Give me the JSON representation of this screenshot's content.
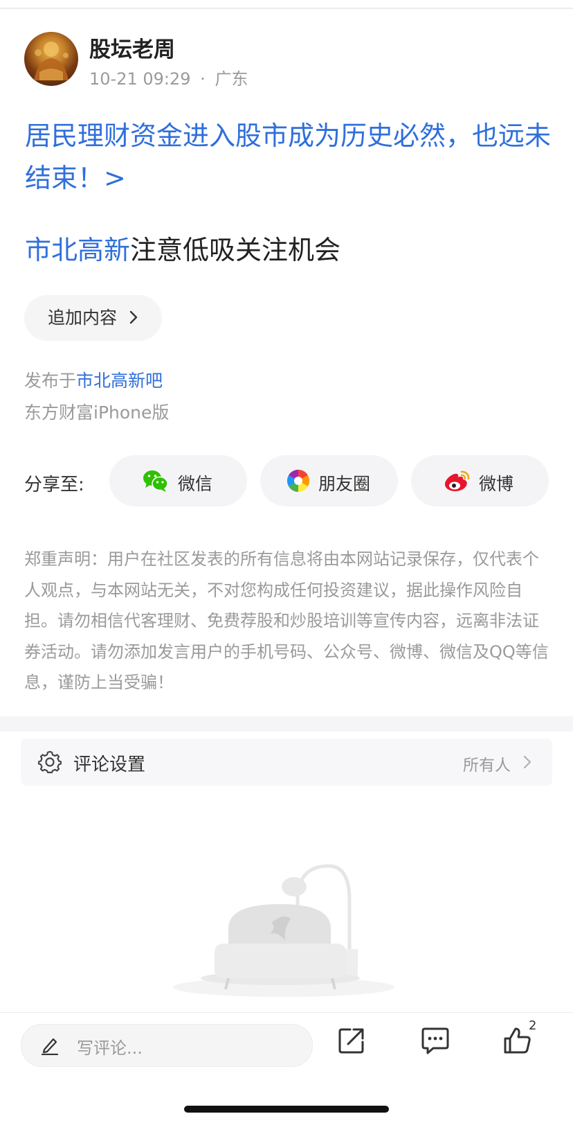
{
  "author": {
    "name": "股坛老周",
    "time": "10-21 09:29",
    "dot": "·",
    "location": "广东"
  },
  "post": {
    "headline": "居民理财资金进入股市成为历史必然，也远未结束！>",
    "subtitle_tag": "市北高新",
    "subtitle_text": "注意低吸关注机会",
    "append_label": "追加内容",
    "published_prefix": "发布于",
    "published_bar": "市北高新吧",
    "device": "东方财富iPhone版"
  },
  "share": {
    "label": "分享至:",
    "buttons": [
      {
        "label": "微信",
        "icon": "wechat-icon"
      },
      {
        "label": "朋友圈",
        "icon": "moments-icon"
      },
      {
        "label": "微博",
        "icon": "weibo-icon"
      }
    ]
  },
  "disclaimer": "郑重声明：用户在社区发表的所有信息将由本网站记录保存，仅代表个人观点，与本网站无关，不对您构成任何投资建议，据此操作风险自担。请勿相信代客理财、免费荐股和炒股培训等宣传内容，远离非法证券活动。请勿添加发言用户的手机号码、公众号、微博、微信及QQ等信息，谨防上当受骗！",
  "comment_settings": {
    "label": "评论设置",
    "value": "所有人"
  },
  "bottom_bar": {
    "comment_placeholder": "写评论...",
    "like_count": "2"
  },
  "colors": {
    "link_blue": "#2f6fdb",
    "muted_gray": "#9a9a9a",
    "wechat_green": "#2dc100",
    "weibo_red": "#e6162d"
  }
}
